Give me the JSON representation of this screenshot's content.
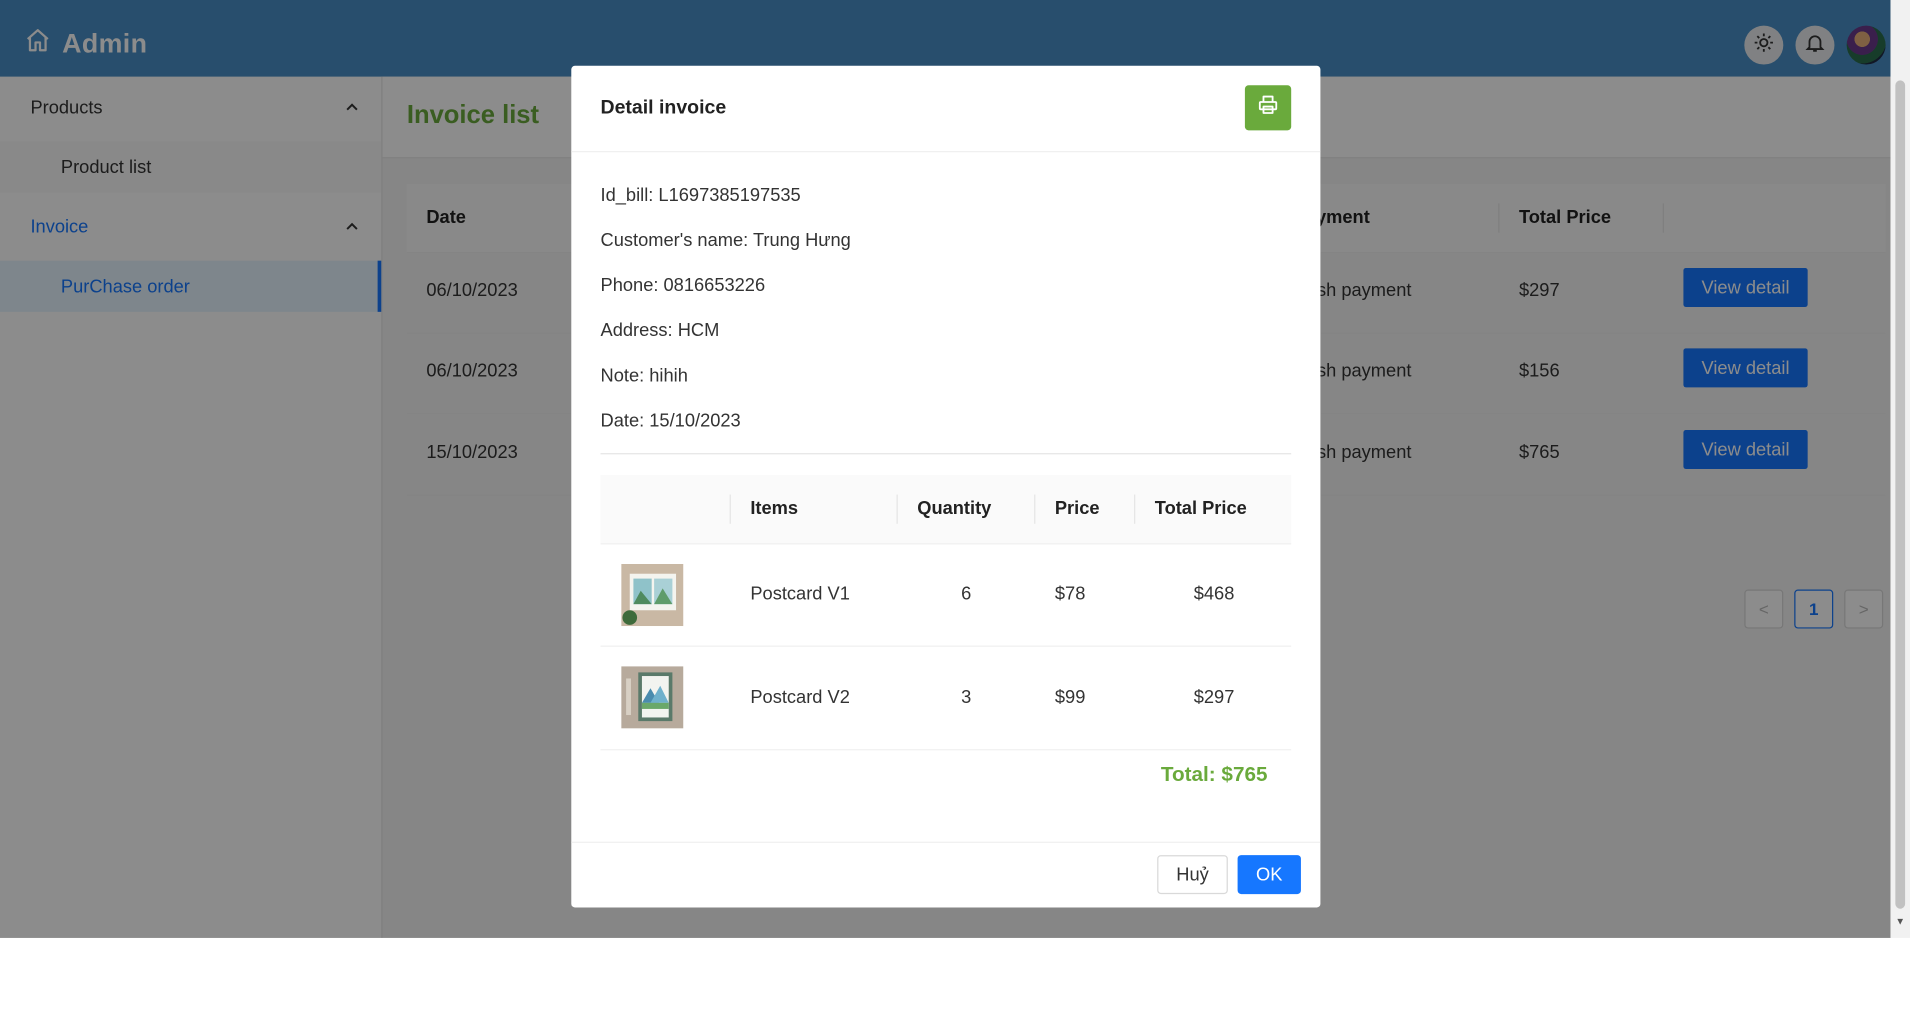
{
  "header": {
    "title": "Admin"
  },
  "sidebar": {
    "groups": [
      {
        "label": "Products",
        "items": [
          {
            "label": "Product list"
          }
        ]
      },
      {
        "label": "Invoice",
        "items": [
          {
            "label": "PurChase order"
          }
        ]
      }
    ]
  },
  "main": {
    "title": "Invoice list",
    "columns": {
      "date": "Date",
      "payment": "Payment",
      "total": "Total Price"
    },
    "rows": [
      {
        "date": "06/10/2023",
        "payment": "Cash payment",
        "total": "$297",
        "action": "View detail"
      },
      {
        "date": "06/10/2023",
        "payment": "Cash payment",
        "total": "$156",
        "action": "View detail"
      },
      {
        "date": "15/10/2023",
        "payment": "Cash payment",
        "total": "$765",
        "action": "View detail"
      }
    ],
    "pagination": {
      "current": "1",
      "prev": "<",
      "next": ">"
    }
  },
  "modal": {
    "title": "Detail invoice",
    "info": {
      "id_bill": "Id_bill: L1697385197535",
      "customer": "Customer's name: Trung Hưng",
      "phone": "Phone: 0816653226",
      "address": "Address: HCM",
      "note": "Note: hihih",
      "date": "Date: 15/10/2023"
    },
    "columns": {
      "items": "Items",
      "quantity": "Quantity",
      "price": "Price",
      "total": "Total Price"
    },
    "items": [
      {
        "name": "Postcard V1",
        "quantity": "6",
        "price": "$78",
        "total": "$468"
      },
      {
        "name": "Postcard V2",
        "quantity": "3",
        "price": "$99",
        "total": "$297"
      }
    ],
    "total": "Total: $765",
    "cancel": "Huỷ",
    "ok": "OK"
  },
  "colors": {
    "header": "#4a8fc6",
    "accent": "#1677ff",
    "green": "#6aaa3c"
  }
}
